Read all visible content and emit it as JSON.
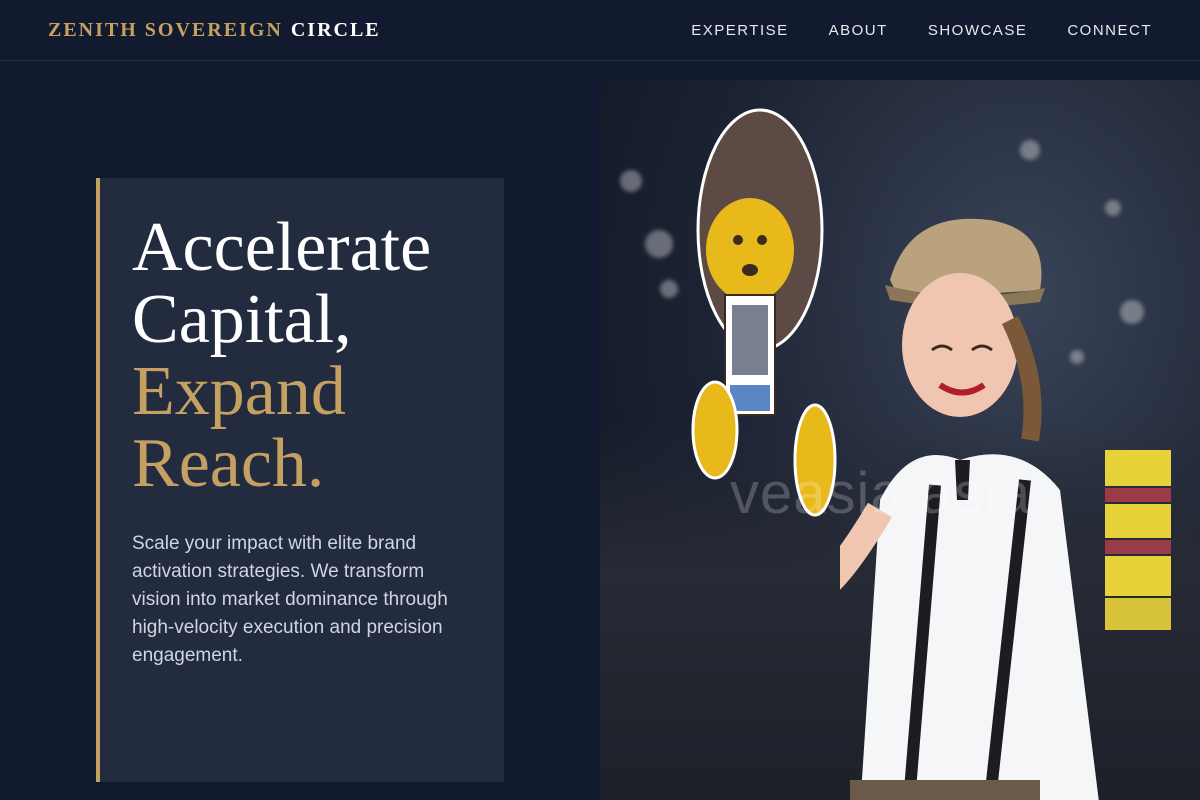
{
  "brand": {
    "part1": "ZENITH SOVEREIGN",
    "part2": "CIRCLE"
  },
  "nav": [
    {
      "label": "EXPERTISE"
    },
    {
      "label": "ABOUT"
    },
    {
      "label": "SHOWCASE"
    },
    {
      "label": "CONNECT"
    }
  ],
  "hero": {
    "line1": "Accelerate",
    "line2": "Capital,",
    "line3": "Expand",
    "line4": "Reach.",
    "description": "Scale your impact with elite brand activation strategies. We transform vision into market dominance through high-velocity execution and precision engagement."
  },
  "photo": {
    "watermark": "veasia.asia"
  },
  "colors": {
    "background": "#111a2e",
    "card": "#232b3f",
    "accent": "#c4a062"
  }
}
